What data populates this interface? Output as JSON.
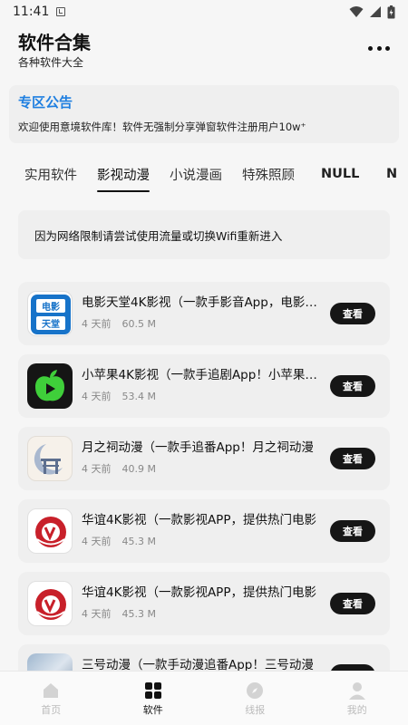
{
  "status_bar": {
    "time": "11:41"
  },
  "header": {
    "title": "软件合集",
    "subtitle": "各种软件大全"
  },
  "announcement": {
    "title": "专区公告",
    "text": "欢迎使用意境软件库！软件无强制分享弹窗软件注册用户10w⁺"
  },
  "tabs": [
    {
      "label": "实用软件"
    },
    {
      "label": "影视动漫"
    },
    {
      "label": "小说漫画"
    },
    {
      "label": "特殊照顾"
    },
    {
      "label": "NULL"
    },
    {
      "label": "N"
    }
  ],
  "notice": "因为网络限制请尝试使用流量或切换Wifi重新进入",
  "apps": [
    {
      "name": "电影天堂4K影视（一款手影音App，电影天堂",
      "time": "4 天前",
      "size": "60.5 M",
      "button": "查看",
      "icon_text_top": "电影",
      "icon_text_bottom": "天堂"
    },
    {
      "name": "小苹果4K影视（一款手追剧App！小苹果4K影视",
      "time": "4 天前",
      "size": "53.4 M",
      "button": "查看"
    },
    {
      "name": "月之祠动漫（一款手追番App！月之祠动漫",
      "time": "4 天前",
      "size": "40.9 M",
      "button": "查看"
    },
    {
      "name": "华谊4K影视（一款影视APP，提供热门电影",
      "time": "4 天前",
      "size": "45.3 M",
      "button": "查看"
    },
    {
      "name": "华谊4K影视（一款影视APP，提供热门电影",
      "time": "4 天前",
      "size": "45.3 M",
      "button": "查看"
    },
    {
      "name": "三号动漫（一款手动漫追番App！三号动漫",
      "time": "",
      "size": "",
      "button": ""
    }
  ],
  "bottom_nav": [
    {
      "label": "首页"
    },
    {
      "label": "软件"
    },
    {
      "label": "线报"
    },
    {
      "label": "我的"
    }
  ]
}
